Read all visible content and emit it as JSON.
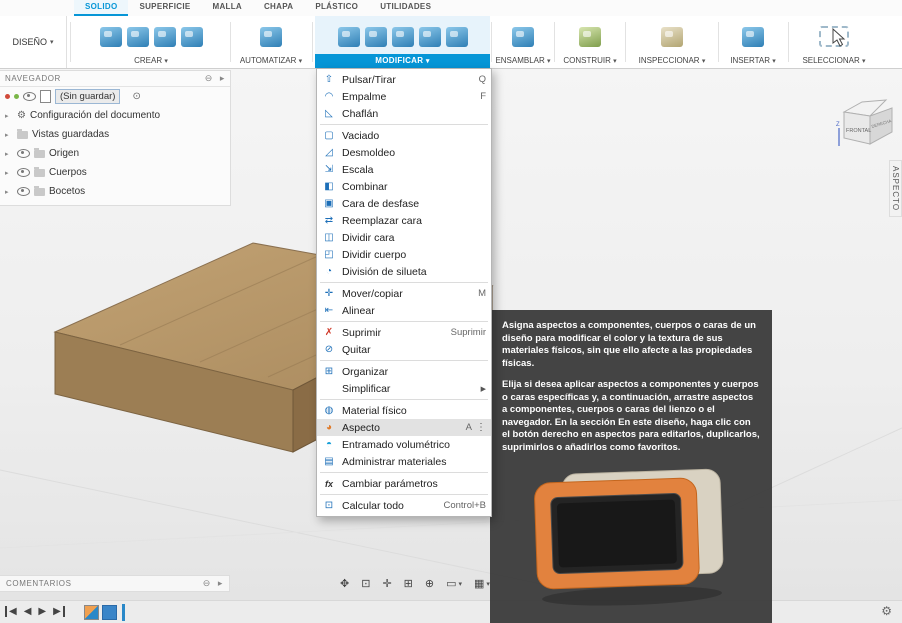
{
  "tabs": [
    {
      "label": "SOLIDO"
    },
    {
      "label": "SUPERFICIE"
    },
    {
      "label": "MALLA"
    },
    {
      "label": "CHAPA"
    },
    {
      "label": "PLÁSTICO"
    },
    {
      "label": "UTILIDADES"
    }
  ],
  "toolbar": {
    "design": "DISEÑO",
    "crear": "CREAR",
    "automatizar": "AUTOMATIZAR",
    "modificar": "MODIFICAR",
    "ensamblar": "ENSAMBLAR",
    "construir": "CONSTRUIR",
    "inspeccionar": "INSPECCIONAR",
    "insertar": "INSERTAR",
    "seleccionar": "SELECCIONAR"
  },
  "browser": {
    "title": "NAVEGADOR",
    "document": "(Sin guardar)",
    "items": [
      {
        "label": "Configuración del documento"
      },
      {
        "label": "Vistas guardadas"
      },
      {
        "label": "Origen"
      },
      {
        "label": "Cuerpos"
      },
      {
        "label": "Bocetos"
      }
    ]
  },
  "modify_menu": {
    "items": [
      {
        "icon": "⇧",
        "label": "Pulsar/Tirar",
        "shortcut": "Q"
      },
      {
        "icon": "◠",
        "label": "Empalme",
        "shortcut": "F"
      },
      {
        "icon": "◺",
        "label": "Chaflán",
        "shortcut": ""
      },
      {
        "icon": "▢",
        "label": "Vaciado",
        "shortcut": ""
      },
      {
        "icon": "◿",
        "label": "Desmoldeo",
        "shortcut": ""
      },
      {
        "icon": "⇲",
        "label": "Escala",
        "shortcut": ""
      },
      {
        "icon": "◧",
        "label": "Combinar",
        "shortcut": ""
      },
      {
        "icon": "▣",
        "label": "Cara de desfase",
        "shortcut": ""
      },
      {
        "icon": "⇄",
        "label": "Reemplazar cara",
        "shortcut": ""
      },
      {
        "icon": "◫",
        "label": "Dividir cara",
        "shortcut": ""
      },
      {
        "icon": "◰",
        "label": "Dividir cuerpo",
        "shortcut": ""
      },
      {
        "icon": "◔",
        "label": "División de silueta",
        "shortcut": ""
      },
      {
        "icon": "✛",
        "label": "Mover/copiar",
        "shortcut": "M"
      },
      {
        "icon": "⇤",
        "label": "Alinear",
        "shortcut": ""
      },
      {
        "icon": "✗",
        "label": "Suprimir",
        "shortcut": "Suprimir"
      },
      {
        "icon": "⊘",
        "label": "Quitar",
        "shortcut": ""
      },
      {
        "icon": "⊞",
        "label": "Organizar",
        "shortcut": ""
      },
      {
        "icon": "",
        "label": "Simplificar",
        "shortcut": ""
      },
      {
        "icon": "◍",
        "label": "Material físico",
        "shortcut": ""
      },
      {
        "icon": "◕",
        "label": "Aspecto",
        "shortcut": "A",
        "highlighted": true
      },
      {
        "icon": "◓",
        "label": "Entramado volumétrico",
        "shortcut": ""
      },
      {
        "icon": "▤",
        "label": "Administrar materiales",
        "shortcut": ""
      },
      {
        "icon": "fx",
        "label": "Cambiar parámetros",
        "shortcut": ""
      },
      {
        "icon": "⊡",
        "label": "Calcular todo",
        "shortcut": "Control+B"
      }
    ]
  },
  "tooltip": {
    "p1": "Asigna aspectos a componentes, cuerpos o caras de un diseño para modificar el color y la textura de sus materiales físicos, sin que ello afecte a las propiedades físicas.",
    "p2": "Elija si desea aplicar aspectos a componentes y cuerpos o caras específicas y, a continuación, arrastre aspectos a componentes, cuerpos o caras del lienzo o el navegador. En la sección En este diseño, haga clic con el botón derecho en aspectos para editarlos, duplicarlos, suprimirlos o añadirlos como favoritos."
  },
  "viewcube": {
    "front": "FRONTAL",
    "right": "DERECHA",
    "axis_z": "Z"
  },
  "aspect_tab": "ASPECTO",
  "comments": {
    "title": "COMENTARIOS"
  },
  "glyphs": {
    "dropdown": "▾",
    "submenu": "▶",
    "menu_more": "⋮",
    "panel_collapse": "⊖",
    "panel_pin": "▸",
    "doc_activate": "⊙",
    "gear": "⚙",
    "nav_orbit": "✥",
    "nav_look_at": "⊡",
    "nav_pan": "✛",
    "nav_zoom_window": "⊞",
    "nav_zoom": "⊕",
    "nav_display": "▭",
    "nav_grid": "▦",
    "pb_first": "◀",
    "pb_prev": "◀",
    "pb_play": "▶",
    "pb_last": "▶"
  }
}
